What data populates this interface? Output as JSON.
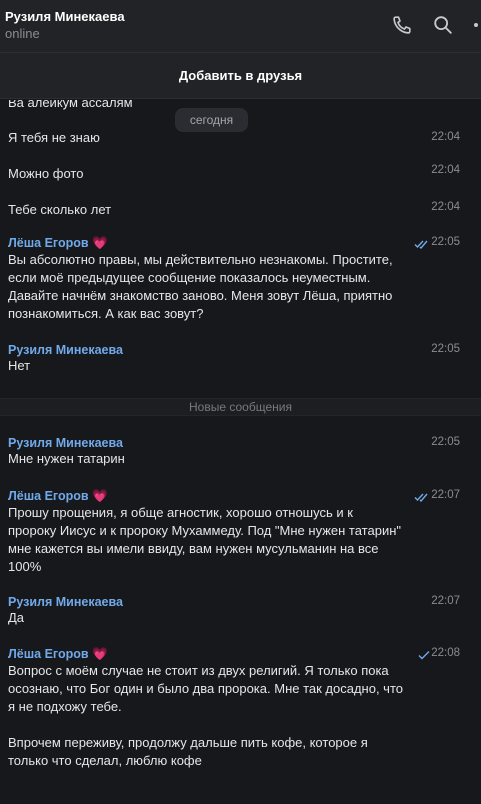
{
  "header": {
    "title": "Рузиля Минекаева",
    "status": "online",
    "icons": [
      "phone-icon",
      "search-icon",
      "more-icon"
    ]
  },
  "add_friend": {
    "label": "Добавить в друзья"
  },
  "date_pill": "сегодня",
  "divider": "Новые сообщения",
  "messages": [
    {
      "text": "Ва алейкум ассалям"
    },
    {
      "text": "Я тебя не знаю",
      "time": "22:04"
    },
    {
      "text": "Можно фото",
      "time": "22:04"
    },
    {
      "text": "Тебе сколько лет",
      "time": "22:04"
    },
    {
      "sender": "Лёша Егоров",
      "heart": "💗",
      "read": true,
      "time": "22:05",
      "text": "Вы абсолютно правы, мы действительно незнакомы. Простите, если моё предыдущее сообщение показалось неуместным. Давайте начнём знакомство заново. Меня зовут Лёша, приятно познакомиться. А как вас зовут?"
    },
    {
      "sender": "Рузиля Минекаева",
      "time": "22:05",
      "text": "Нет"
    },
    {
      "sender": "Рузиля Минекаева",
      "time": "22:05",
      "text": "Мне нужен татарин"
    },
    {
      "sender": "Лёша Егоров",
      "heart": "💗",
      "read": true,
      "time": "22:07",
      "text": "Прошу прощения, я обще агностик, хорошо отношусь и к пророку Иисус и к пророку Мухаммеду. Под \"Мне нужен татарин\" мне кажется вы имели ввиду, вам нужен мусульманин на все 100%"
    },
    {
      "sender": "Рузиля Минекаева",
      "time": "22:07",
      "text": "Да"
    },
    {
      "sender": "Лёша Егоров",
      "heart": "💗",
      "read": false,
      "time": "22:08",
      "text": "Вопрос с моём случае не стоит из двух религий. Я только пока осознаю, что Бог один и было два пророка. Мне так досадно, что я не подхожу тебе.\n\nВпрочем переживу, продолжу дальше пить кофе, которое я только что сделал, люблю кофе"
    }
  ],
  "colors": {
    "background": "#17181b",
    "header": "#222327",
    "sender": "#71aaeb",
    "muted": "#8a8c91"
  }
}
